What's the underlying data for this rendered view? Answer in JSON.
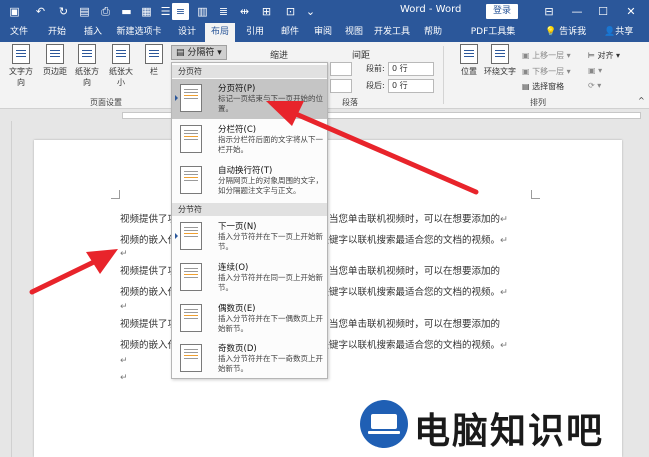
{
  "window": {
    "doc_title": "Word - Word",
    "login_label": "登录",
    "quick_access_icons": [
      "save-icon",
      "undo-icon",
      "redo-icon",
      "new-doc-icon",
      "open-icon",
      "layout-icon",
      "list-icon",
      "table-icon",
      "ruler-icon",
      "align-icon",
      "zoom-icon",
      "more-icon"
    ],
    "controls": [
      "ribbon-options-icon",
      "minimize-icon",
      "restore-icon",
      "close-icon"
    ]
  },
  "tabs": [
    {
      "label": "文件"
    },
    {
      "label": "开始"
    },
    {
      "label": "插入"
    },
    {
      "label": "新建选项卡"
    },
    {
      "label": "设计"
    },
    {
      "label": "布局"
    },
    {
      "label": "引用"
    },
    {
      "label": "邮件"
    },
    {
      "label": "审阅"
    },
    {
      "label": "视图"
    },
    {
      "label": "开发工具"
    },
    {
      "label": "帮助"
    },
    {
      "label": "PDF工具集"
    }
  ],
  "active_tab": "布局",
  "tell_me": "告诉我",
  "share": "共享",
  "ribbon": {
    "page_setup_buttons": [
      "文字方向",
      "页边距",
      "纸张方向",
      "纸张大小",
      "栏"
    ],
    "page_setup_group": "页面设置",
    "breaks_button": "分隔符",
    "indent_label": "缩进",
    "spacing_label": "间距",
    "spacing_before_label": "段前:",
    "spacing_before_value": "0 行",
    "spacing_after_label": "段后:",
    "spacing_after_value": "0 行",
    "paragraph_group": "段落",
    "position_label": "位置",
    "wrap_label": "环绕文字",
    "bring_forward": "上移一层",
    "send_backward": "下移一层",
    "selection_pane": "选择窗格",
    "align": "对齐",
    "arrange_group": "排列"
  },
  "dropdown": {
    "page_breaks_header": "分页符",
    "section_breaks_header": "分节符",
    "items": [
      {
        "title": "分页符(P)",
        "desc": "标记一页结束与下一页开始的位置。",
        "highlighted": true
      },
      {
        "title": "分栏符(C)",
        "desc": "指示分栏符后面的文字将从下一栏开始。",
        "highlighted": false
      },
      {
        "title": "自动换行符(T)",
        "desc": "分隔网页上的对象周围的文字，如分隔题注文字与正文。",
        "highlighted": false
      },
      {
        "title": "下一页(N)",
        "desc": "插入分节符并在下一页上开始新节。",
        "highlighted": false
      },
      {
        "title": "连续(O)",
        "desc": "插入分节符并在同一页上开始新节。",
        "highlighted": false
      },
      {
        "title": "偶数页(E)",
        "desc": "插入分节符并在下一偶数页上开始新节。",
        "highlighted": false
      },
      {
        "title": "奇数页(D)",
        "desc": "插入分节符并在下一奇数页上开始新节。",
        "highlighted": false
      }
    ]
  },
  "document": {
    "lines": [
      "视频提供了功能强大的方法帮助您证明您的观点。当您单击联机视频时，可以在想要添加的",
      "视频的嵌入代码中进行粘贴。您也可以键入一个关键字以联机搜索最适合您的文档的视频。",
      "视频提供了功能强大的方法帮助您证明您的观点。当您单击联机视频时，可以在想要添加的",
      "视频的嵌入代码中进行粘贴。您也可以键入一个关键字以联机搜索最适合您的文档的视频。",
      "视频提供了功能强大的方法帮助您证明您的观点。当您单击联机视频时，可以在想要添加的",
      "视频的嵌入代码中进行粘贴。您也可以键入一个关键字以联机搜索最适合您的文档的视频。"
    ],
    "paragraph_mark": "↵"
  },
  "watermark": {
    "text": "电脑知识吧"
  },
  "colors": {
    "accent": "#2b579a",
    "arrow": "#e8242b",
    "watermark_blue": "#1f5fb4"
  }
}
